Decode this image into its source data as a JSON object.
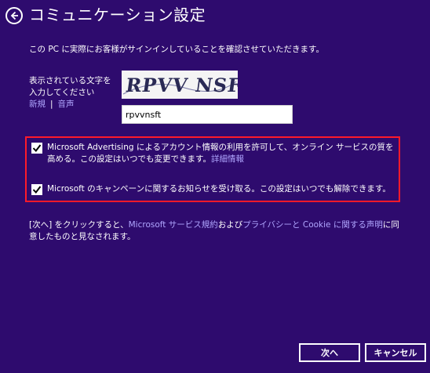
{
  "header": {
    "title": "コミュニケーション設定",
    "back_icon": "back-arrow-icon"
  },
  "intro_text": "この PC に実際にお客様がサインインしていることを確認させていただきます。",
  "captcha": {
    "label": "表示されている文字を入力してください",
    "new_link": "新規",
    "separator": "|",
    "audio_link": "音声",
    "image_text": "RPVV NSFt",
    "input_value": "rpvvnsft"
  },
  "options": [
    {
      "text": "Microsoft Advertising によるアカウント情報の利用を許可して、オンライン サービスの質を高める。この設定はいつでも変更できます。",
      "link": "詳細情報",
      "checked": true
    },
    {
      "text": "Microsoft のキャンペーンに関するお知らせを受け取る。この設定はいつでも解除できます。",
      "checked": true
    }
  ],
  "consent": {
    "part1": "[次へ] をクリックすると、",
    "link1": "Microsoft サービス規約",
    "part2": "および",
    "link2": "プライバシーと Cookie に関する声明",
    "part3": "に同意したものと見なされます。"
  },
  "buttons": {
    "next": "次へ",
    "cancel": "キャンセル"
  },
  "colors": {
    "background": "#2e0b6e",
    "link": "#b0a6ff",
    "highlight_border": "#ff1a2a"
  }
}
